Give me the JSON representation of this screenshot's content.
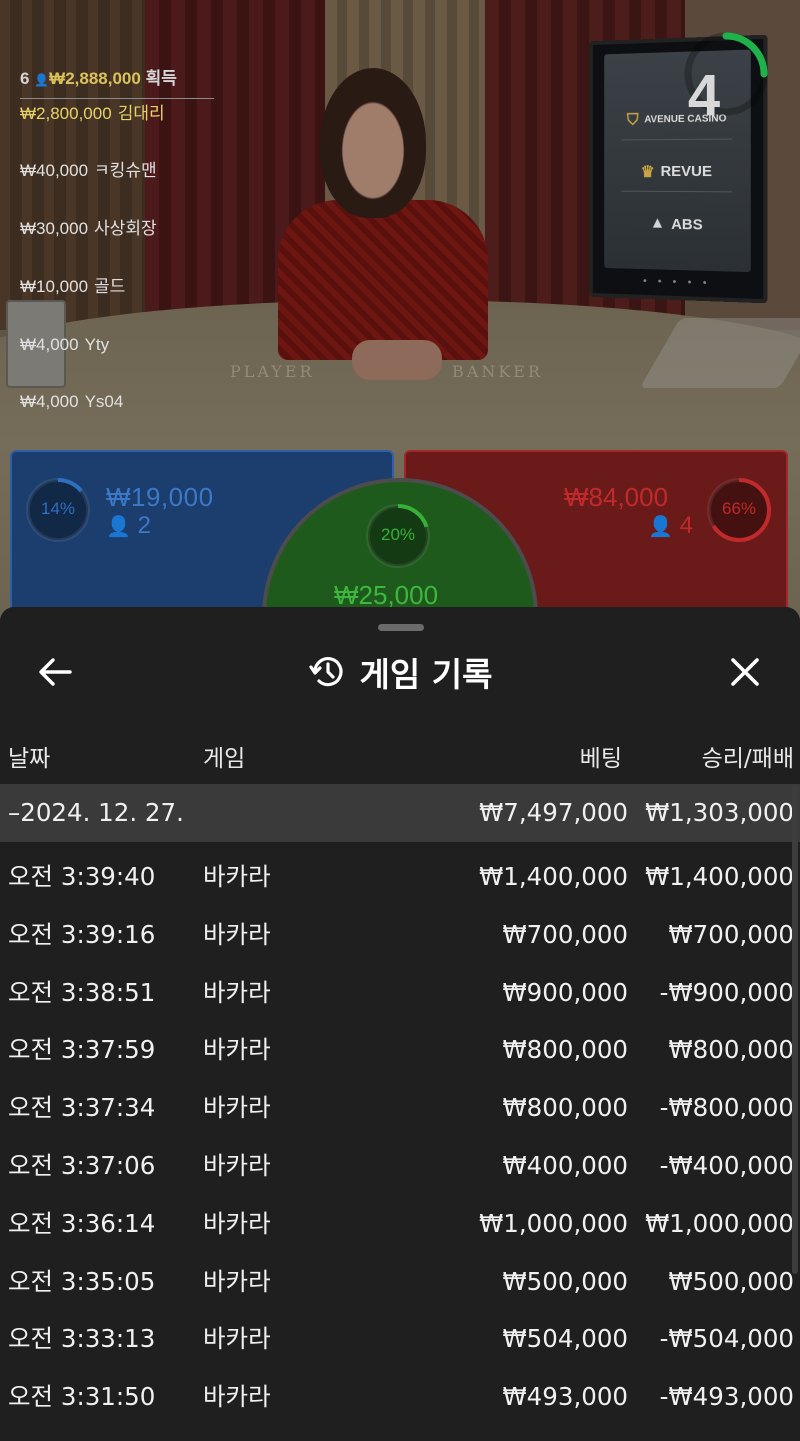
{
  "live": {
    "countdown": "4",
    "felt_labels": {
      "player": "PLAYER",
      "banker": "BANKER"
    },
    "promo_logos": [
      {
        "name": "AVENUE CASINO",
        "icon": "shield-icon"
      },
      {
        "name": "REVUE",
        "icon": "crown-icon"
      },
      {
        "name": "ABS",
        "icon": "arrow-logo-icon"
      }
    ],
    "winners": {
      "count": "6",
      "total": "₩2,888,000",
      "suffix": "획득",
      "list": [
        {
          "amount": "₩2,800,000",
          "name": "김대리"
        },
        {
          "amount": "₩40,000",
          "name": "ㅋ킹슈맨"
        },
        {
          "amount": "₩30,000",
          "name": "사상회장"
        },
        {
          "amount": "₩10,000",
          "name": "골드"
        },
        {
          "amount": "₩4,000",
          "name": "Yty"
        },
        {
          "amount": "₩4,000",
          "name": "Ys04"
        }
      ]
    },
    "bets": {
      "player": {
        "percent": "14%",
        "amount": "₩19,000",
        "players": "2",
        "color": "#2f6fc0",
        "fraction": 0.14
      },
      "tie": {
        "percent": "20%",
        "amount": "₩25,000",
        "color": "#37b037",
        "fraction": 0.2
      },
      "banker": {
        "percent": "66%",
        "amount": "₩84,000",
        "players": "4",
        "color": "#c02a2a",
        "fraction": 0.66
      }
    }
  },
  "history": {
    "title": "게임 기록",
    "columns": {
      "date": "날짜",
      "game": "게임",
      "bet": "베팅",
      "result": "승리/패배"
    },
    "date_group": {
      "label": "–2024. 12. 27.",
      "bet": "₩7,497,000",
      "result": "₩1,303,000"
    },
    "rows": [
      {
        "time": "오전 3:39:40",
        "game": "바카라",
        "bet": "₩1,400,000",
        "result": "₩1,400,000"
      },
      {
        "time": "오전 3:39:16",
        "game": "바카라",
        "bet": "₩700,000",
        "result": "₩700,000"
      },
      {
        "time": "오전 3:38:51",
        "game": "바카라",
        "bet": "₩900,000",
        "result": "-₩900,000"
      },
      {
        "time": "오전 3:37:59",
        "game": "바카라",
        "bet": "₩800,000",
        "result": "₩800,000"
      },
      {
        "time": "오전 3:37:34",
        "game": "바카라",
        "bet": "₩800,000",
        "result": "-₩800,000"
      },
      {
        "time": "오전 3:37:06",
        "game": "바카라",
        "bet": "₩400,000",
        "result": "-₩400,000"
      },
      {
        "time": "오전 3:36:14",
        "game": "바카라",
        "bet": "₩1,000,000",
        "result": "₩1,000,000"
      },
      {
        "time": "오전 3:35:05",
        "game": "바카라",
        "bet": "₩500,000",
        "result": "₩500,000"
      },
      {
        "time": "오전 3:33:13",
        "game": "바카라",
        "bet": "₩504,000",
        "result": "-₩504,000"
      },
      {
        "time": "오전 3:31:50",
        "game": "바카라",
        "bet": "₩493,000",
        "result": "-₩493,000"
      }
    ]
  }
}
